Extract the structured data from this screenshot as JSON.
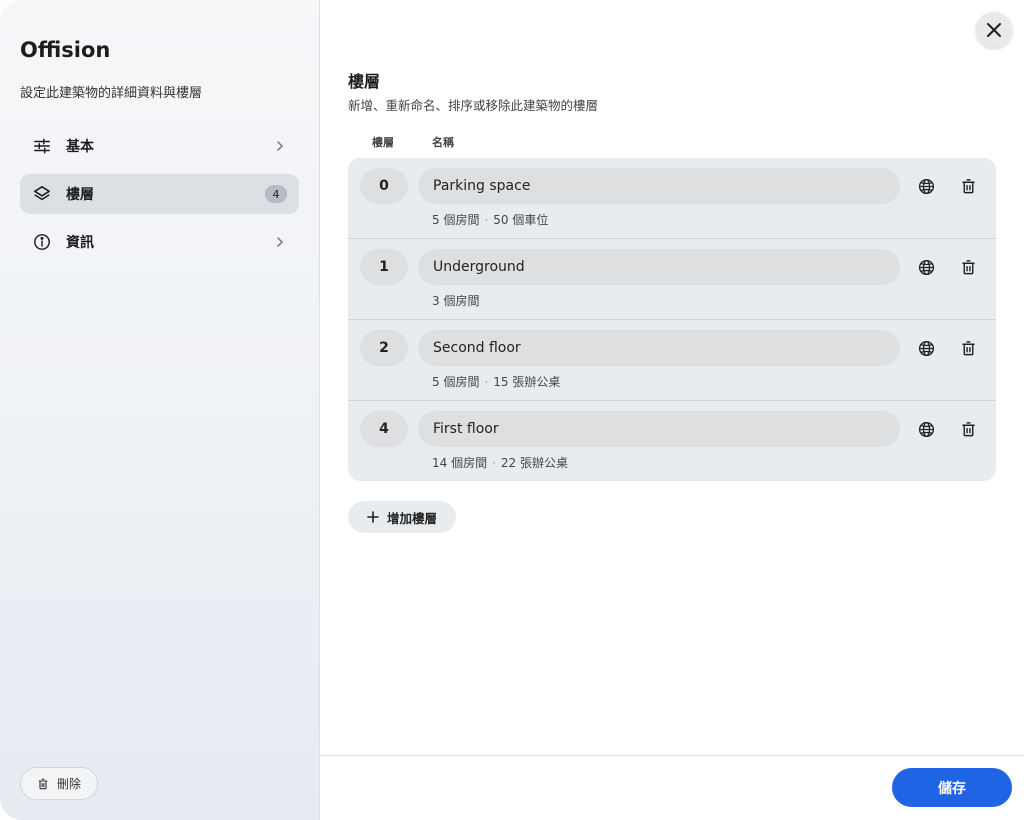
{
  "sidebar": {
    "title": "Offision",
    "subtitle": "設定此建築物的詳細資料與樓層",
    "items": [
      {
        "label": "基本",
        "icon": "sliders-icon"
      },
      {
        "label": "樓層",
        "icon": "layers-icon",
        "badge": "4"
      },
      {
        "label": "資訊",
        "icon": "info-icon"
      }
    ],
    "delete_label": "刪除"
  },
  "main": {
    "title": "樓層",
    "subtitle": "新增、重新命名、排序或移除此建築物的樓層",
    "col_floor": "樓層",
    "col_name": "名稱",
    "floors": [
      {
        "number": "0",
        "name": "Parking space",
        "meta1": "5 個房間",
        "meta2": "50 個車位"
      },
      {
        "number": "1",
        "name": "Underground",
        "meta1": "3 個房間",
        "meta2": ""
      },
      {
        "number": "2",
        "name": "Second floor",
        "meta1": "5 個房間",
        "meta2": "15 張辦公桌"
      },
      {
        "number": "4",
        "name": "First floor",
        "meta1": "14 個房間",
        "meta2": "22 張辦公桌"
      }
    ],
    "add_floor_label": "增加樓層",
    "save_label": "儲存"
  },
  "colors": {
    "accent": "#1f64e5",
    "list_bg": "#e9ecef"
  }
}
